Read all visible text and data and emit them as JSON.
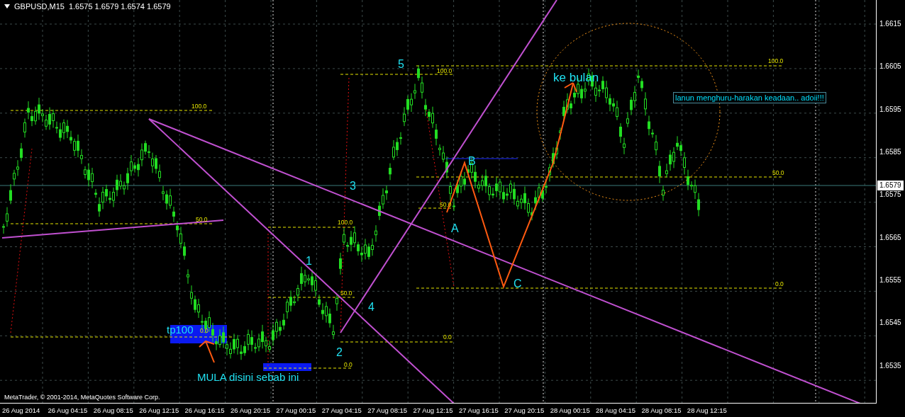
{
  "header": {
    "title": "GBPUSD,M15",
    "quote": "1.6575 1.6579 1.6574 1.6579"
  },
  "price_axis": {
    "labels": [
      "1.6615",
      "1.6605",
      "1.6595",
      "1.6585",
      "1.6575",
      "1.6565",
      "1.6555",
      "1.6545",
      "1.6535"
    ],
    "current_price": "1.6579"
  },
  "time_axis": {
    "labels": [
      "26 Aug 2014",
      "26 Aug 04:15",
      "26 Aug 08:15",
      "26 Aug 12:15",
      "26 Aug 16:15",
      "26 Aug 20:15",
      "27 Aug 00:15",
      "27 Aug 04:15",
      "27 Aug 08:15",
      "27 Aug 12:15",
      "27 Aug 16:15",
      "27 Aug 20:15",
      "28 Aug 00:15",
      "28 Aug 04:15",
      "28 Aug 08:15",
      "28 Aug 12:15"
    ]
  },
  "fib_labels": [
    "100.0",
    "50.0",
    "0.0",
    "100.0",
    "50.0",
    "0.0",
    "0.0",
    "100.0",
    "50.0",
    "100.0",
    "50.0",
    "0.0"
  ],
  "wave_labels": [
    "5",
    "3",
    "1",
    "4",
    "2",
    "A",
    "B",
    "C"
  ],
  "annotations": {
    "tp": "tp100",
    "start_note": "MULA disini sebab ini",
    "target_note": "ke bulan",
    "comment_box": "lanun menghuru-harakan keadaan.. adoii!!!"
  },
  "copyright": "MetaTrader, © 2001-2014, MetaQuotes Software Corp."
}
